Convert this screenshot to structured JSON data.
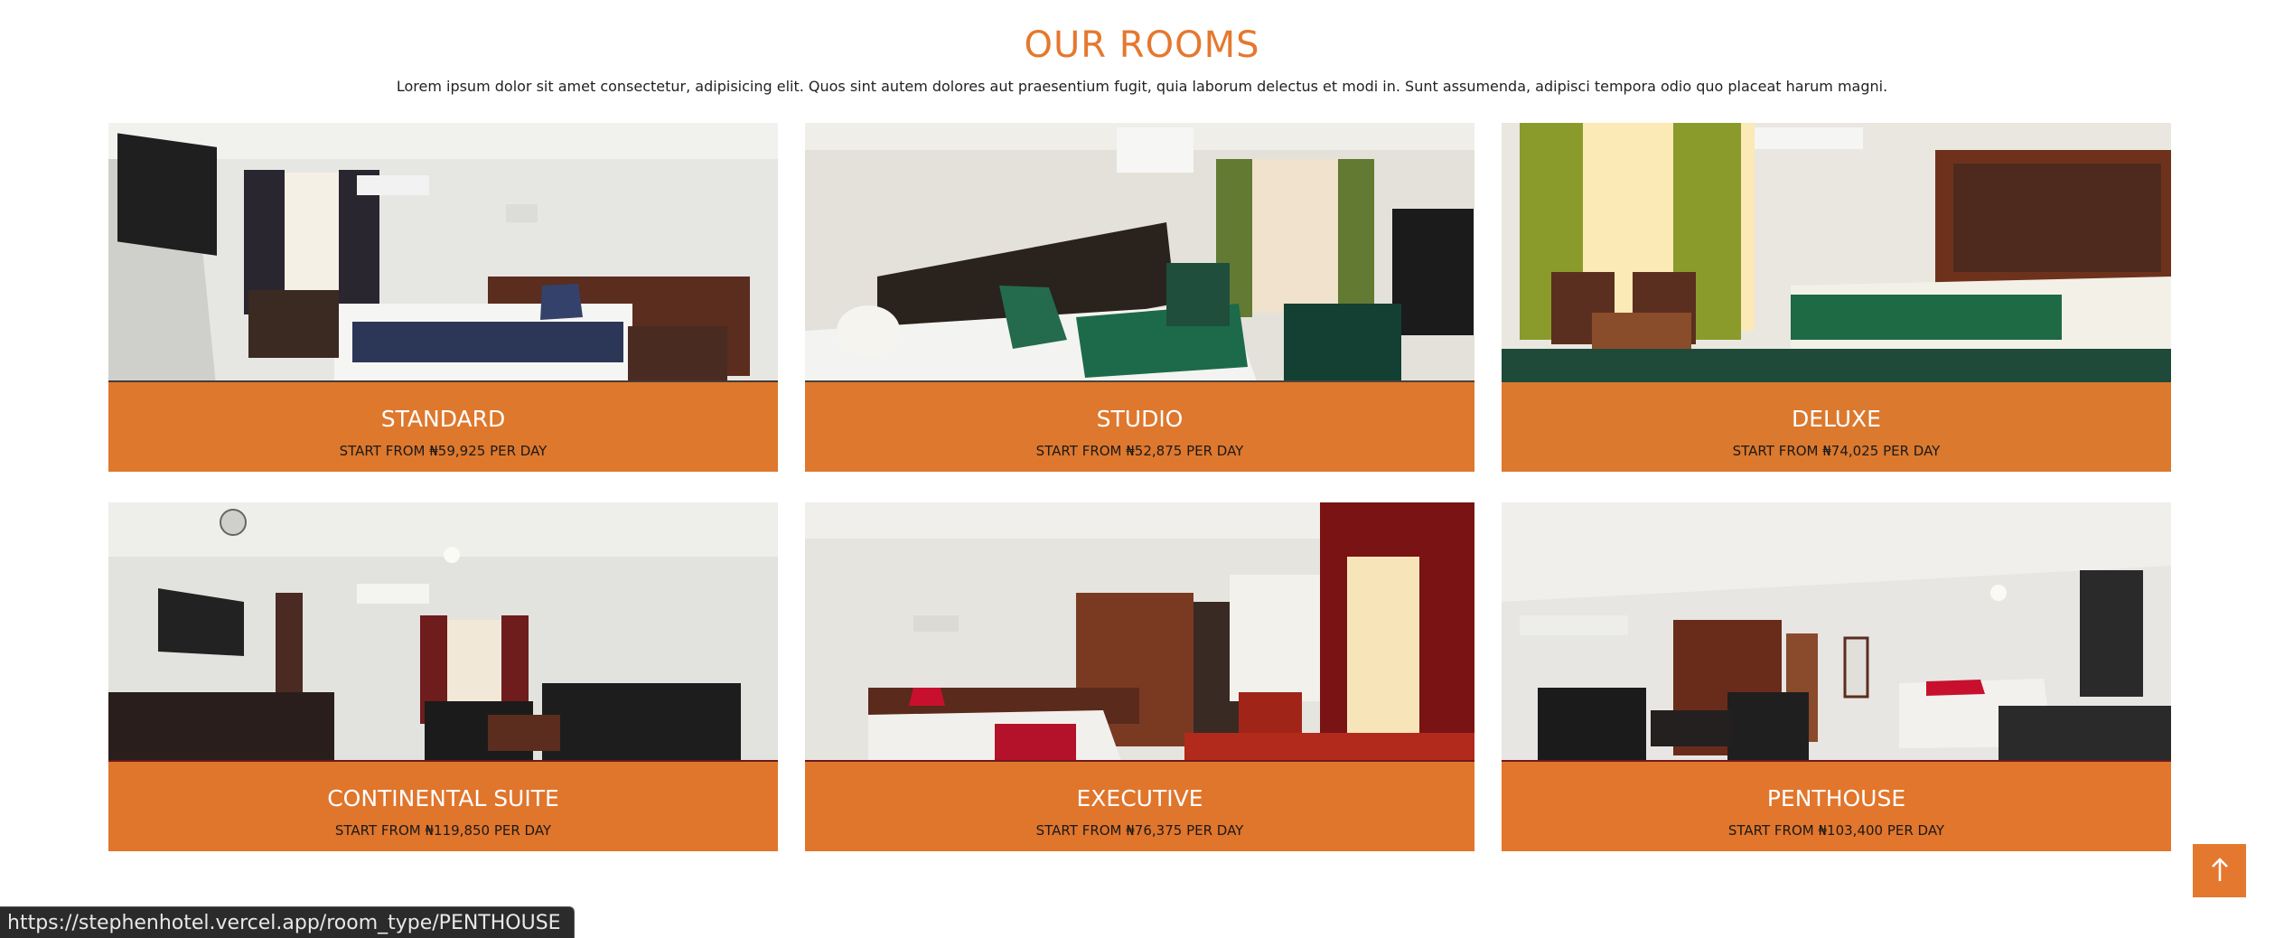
{
  "section": {
    "title": "OUR ROOMS",
    "intro": "Lorem ipsum dolor sit amet consectetur, adipisicing elit. Quos sint autem dolores aut praesentium fugit, quia laborum delectus et modi in. Sunt assumenda, adipisci tempora odio quo placeat harum magni."
  },
  "rooms": [
    {
      "name": "STANDARD",
      "price": "START FROM ₦59,925 PER DAY"
    },
    {
      "name": "STUDIO",
      "price": "START FROM ₦52,875 PER DAY"
    },
    {
      "name": "DELUXE",
      "price": "START FROM ₦74,025 PER DAY"
    },
    {
      "name": "CONTINENTAL SUITE",
      "price": "START FROM ₦119,850 PER DAY"
    },
    {
      "name": "EXECUTIVE",
      "price": "START FROM ₦76,375 PER DAY"
    },
    {
      "name": "PENTHOUSE",
      "price": "START FROM ₦103,400 PER DAY"
    }
  ],
  "scroll_top": {
    "icon": "arrow-up-icon",
    "glyph": "↑"
  },
  "status_bar": {
    "url": "https://stephenhotel.vercel.app/room_type/PENTHOUSE"
  },
  "colors": {
    "accent": "#e5782f",
    "caption_overlay": "#e97d2d"
  }
}
